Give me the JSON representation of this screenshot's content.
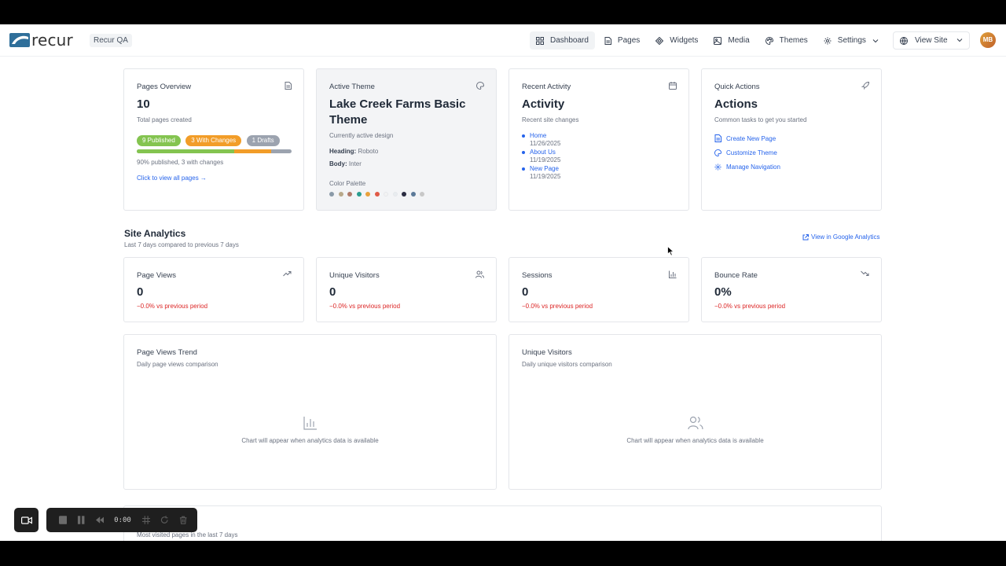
{
  "header": {
    "logo_text": "recur",
    "site_badge": "Recur QA",
    "nav": [
      {
        "label": "Dashboard",
        "icon": "dashboard-icon",
        "active": true
      },
      {
        "label": "Pages",
        "icon": "document-icon"
      },
      {
        "label": "Widgets",
        "icon": "widgets-icon"
      },
      {
        "label": "Media",
        "icon": "image-icon"
      },
      {
        "label": "Themes",
        "icon": "palette-icon"
      },
      {
        "label": "Settings",
        "icon": "gear-icon"
      }
    ],
    "view_site": "View Site",
    "avatar_initials": "MB"
  },
  "pages_overview": {
    "title": "Pages Overview",
    "count": "10",
    "subtitle": "Total pages created",
    "pills": {
      "published": "9 Published",
      "changes": "3 With Changes",
      "drafts": "1 Drafts"
    },
    "progress": {
      "published_pct": 90,
      "changes_pct": 30
    },
    "progress_text": "90% published, 3 with changes",
    "link": "Click to view all pages →"
  },
  "active_theme": {
    "title": "Active Theme",
    "name": "Lake Creek Farms Basic Theme",
    "subtitle": "Currently active design",
    "heading_label": "Heading:",
    "heading_font": "Roboto",
    "body_label": "Body:",
    "body_font": "Inter",
    "palette_label": "Color Palette",
    "palette": [
      "#8a9aa8",
      "#b8a88a",
      "#b07a6a",
      "#2a9d8f",
      "#e9a13b",
      "#e05a47",
      "#f3f3f3",
      "#e8ecef",
      "#2b2d42",
      "#5c7a99",
      "#c8c8c8"
    ]
  },
  "recent_activity": {
    "title": "Recent Activity",
    "heading": "Activity",
    "subtitle": "Recent site changes",
    "items": [
      {
        "name": "Home",
        "date": "11/26/2025"
      },
      {
        "name": "About Us",
        "date": "11/19/2025"
      },
      {
        "name": "New Page",
        "date": "11/19/2025"
      }
    ]
  },
  "quick_actions": {
    "title": "Quick Actions",
    "heading": "Actions",
    "subtitle": "Common tasks to get you started",
    "items": [
      {
        "label": "Create New Page",
        "icon": "document-icon"
      },
      {
        "label": "Customize Theme",
        "icon": "palette-icon"
      },
      {
        "label": "Manage Navigation",
        "icon": "gear-icon"
      }
    ]
  },
  "analytics": {
    "title": "Site Analytics",
    "subtitle": "Last 7 days compared to previous 7 days",
    "ga_link": "View in Google Analytics",
    "metrics": [
      {
        "label": "Page Views",
        "value": "0",
        "change": "−0.0% vs previous period",
        "icon": "trending-up-icon"
      },
      {
        "label": "Unique Visitors",
        "value": "0",
        "change": "−0.0% vs previous period",
        "icon": "users-icon"
      },
      {
        "label": "Sessions",
        "value": "0",
        "change": "−0.0% vs previous period",
        "icon": "bar-chart-icon"
      },
      {
        "label": "Bounce Rate",
        "value": "0%",
        "change": "−0.0% vs previous period",
        "icon": "trending-down-icon"
      }
    ],
    "trend": {
      "title": "Page Views Trend",
      "subtitle": "Daily page views comparison",
      "empty": "Chart will appear when analytics data is available"
    },
    "visitors": {
      "title": "Unique Visitors",
      "subtitle": "Daily unique visitors comparison",
      "empty": "Chart will appear when analytics data is available"
    },
    "top_pages_subtitle": "Most visited pages in the last 7 days"
  },
  "recorder": {
    "time": "0:00"
  },
  "colors": {
    "published": "#84c450",
    "changes": "#f29d28",
    "drafts": "#9ca3af",
    "link": "#2563eb",
    "negative": "#dc2626"
  }
}
